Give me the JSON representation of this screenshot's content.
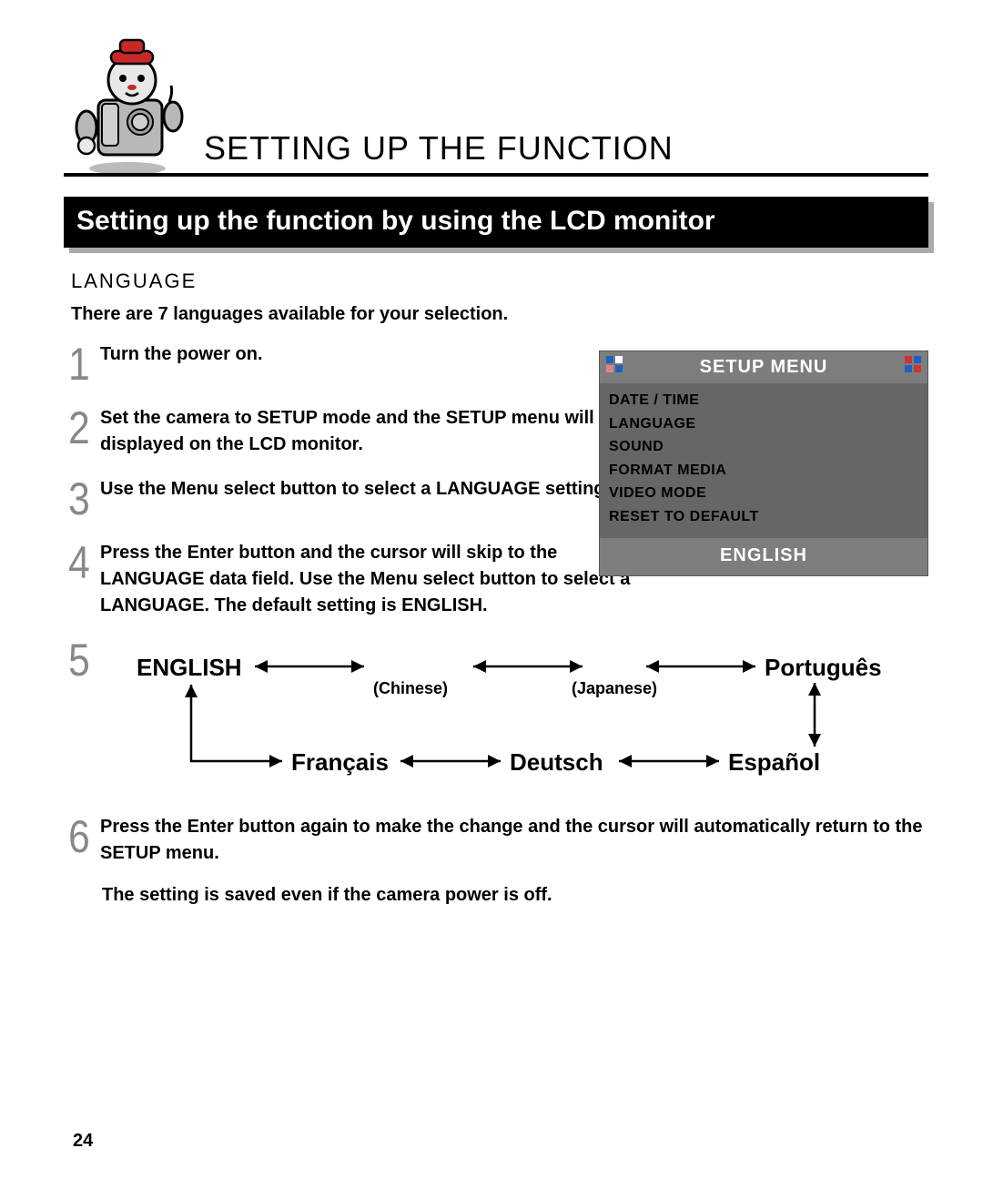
{
  "header": {
    "title": "SETTING UP THE FUNCTION",
    "banner": "Setting up the function by using the LCD monitor"
  },
  "section": {
    "label": "LANGUAGE",
    "intro": "There are 7 languages available for your selection."
  },
  "steps": {
    "s1": {
      "num": "1",
      "text": "Turn the power on."
    },
    "s2": {
      "num": "2",
      "text": "Set the camera to SETUP mode and the SETUP menu will be displayed on the LCD monitor."
    },
    "s3": {
      "num": "3",
      "text": "Use the Menu select button to select a LANGUAGE setting."
    },
    "s4": {
      "num": "4",
      "text": "Press the Enter button and the cursor will skip to the LANGUAGE data field. Use the Menu select button to select a LANGUAGE. The default setting is ENGLISH."
    },
    "s5": {
      "num": "5"
    },
    "s6": {
      "num": "6",
      "text": "Press the Enter button again to make the change and the cursor will automatically return to the SETUP menu."
    }
  },
  "lcd": {
    "title": "SETUP MENU",
    "items": {
      "i0": "DATE / TIME",
      "i1": "LANGUAGE",
      "i2": "SOUND",
      "i3": "FORMAT MEDIA",
      "i4": "VIDEO MODE",
      "i5": "RESET TO DEFAULT"
    },
    "current": "ENGLISH"
  },
  "languages": {
    "english": "ENGLISH",
    "chinese_paren": "(Chinese)",
    "japanese_paren": "(Japanese)",
    "portugues": "Português",
    "francais": "Français",
    "deutsch": "Deutsch",
    "espanol": "Español"
  },
  "footnote": "The setting is saved even if the camera power is off.",
  "page_number": "24"
}
